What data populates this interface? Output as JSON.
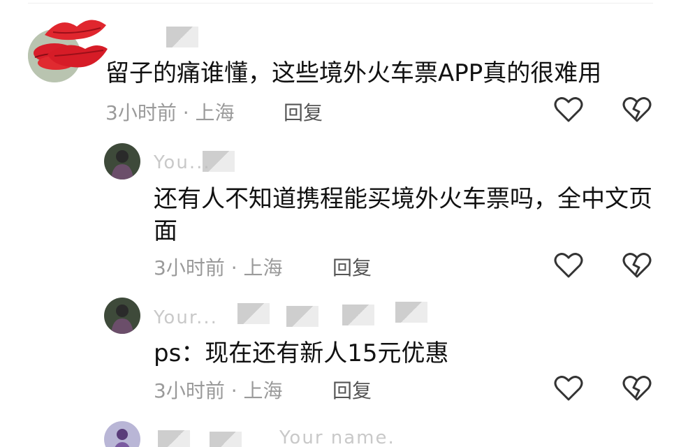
{
  "comments": [
    {
      "text": "留子的痛谁懂，这些境外火车票APP真的很难用",
      "time": "3小时前",
      "location": "上海",
      "reply_label": "回复"
    },
    {
      "username_partial": "You...",
      "text": "还有人不知道携程能买境外火车票吗，全中文页面",
      "time": "3小时前",
      "location": "上海",
      "reply_label": "回复"
    },
    {
      "username_partial": "Your...",
      "text": "ps：现在还有新人15元优惠",
      "time": "3小时前",
      "location": "上海",
      "reply_label": "回复"
    },
    {
      "username_partial": "Your name."
    }
  ],
  "meta_separator": "·",
  "icons": {
    "like": "heart-outline-icon",
    "dislike": "broken-heart-icon"
  }
}
